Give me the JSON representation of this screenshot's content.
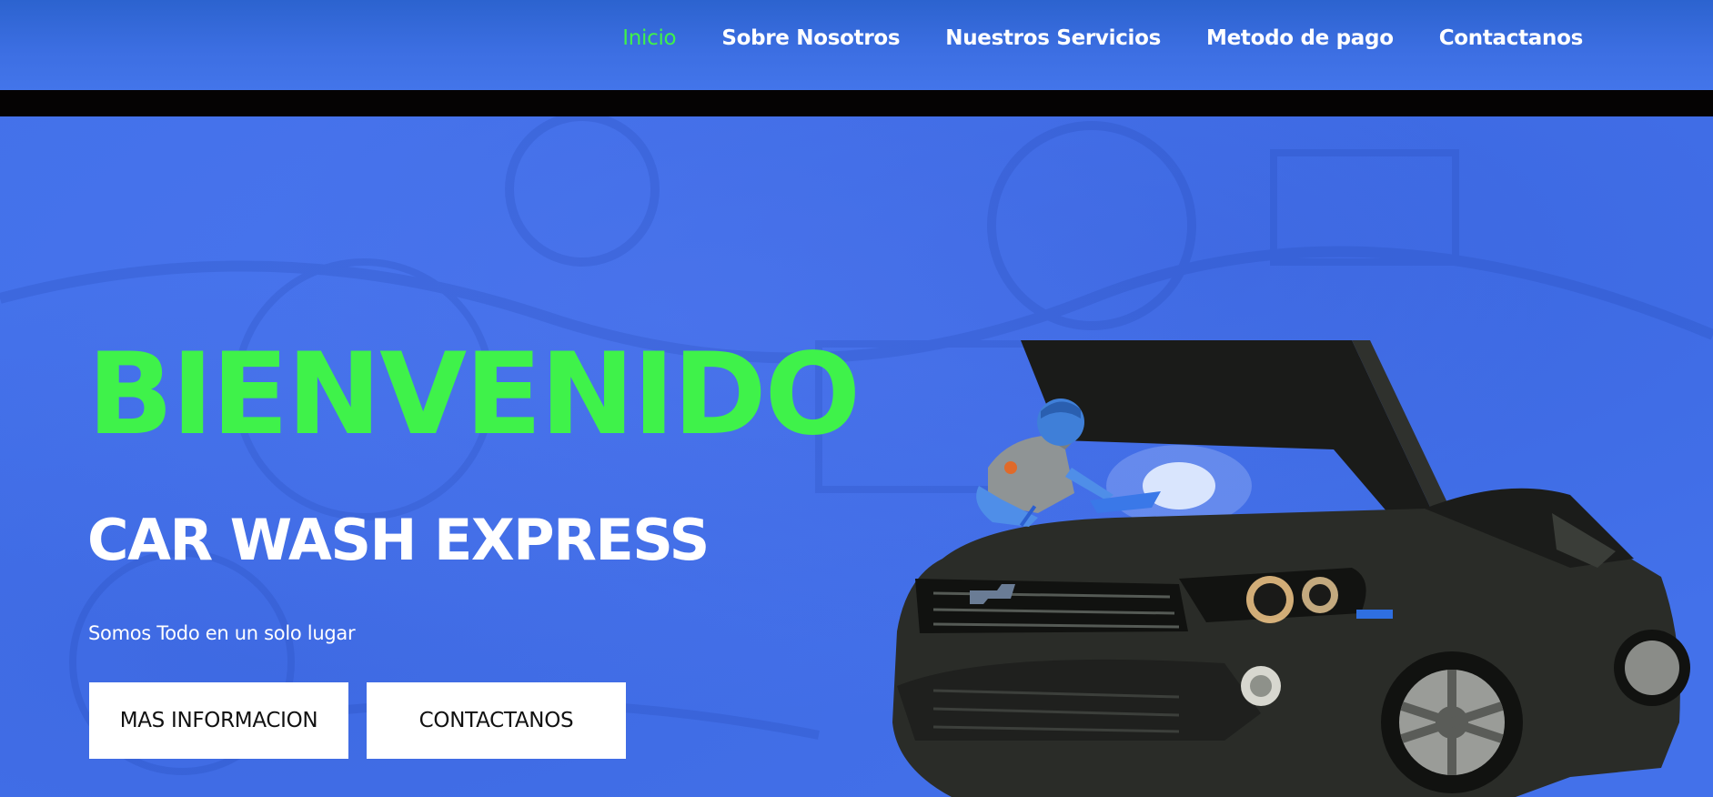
{
  "nav": {
    "items": [
      {
        "label": "Inicio",
        "active": true
      },
      {
        "label": "Sobre Nosotros",
        "active": false
      },
      {
        "label": "Nuestros Servicios",
        "active": false
      },
      {
        "label": "Metodo de pago",
        "active": false
      },
      {
        "label": "Contactanos",
        "active": false
      }
    ]
  },
  "hero": {
    "welcome": "BIENVENIDO",
    "brand": "CAR WASH EXPRESS",
    "tagline": "Somos Todo en un solo lugar",
    "buttons": {
      "info_label": "MAS INFORMACION",
      "contact_label": "CONTACTANOS"
    },
    "image_alt": "mechanic-inspecting-car-engine"
  },
  "colors": {
    "nav_bar": "#3a6ee0",
    "hero_bg": "#4470ea",
    "accent_green": "#3ff24a",
    "separator": "#050303",
    "button_bg": "#ffffff",
    "button_text": "#111111",
    "car_body": "#2a2c28"
  }
}
